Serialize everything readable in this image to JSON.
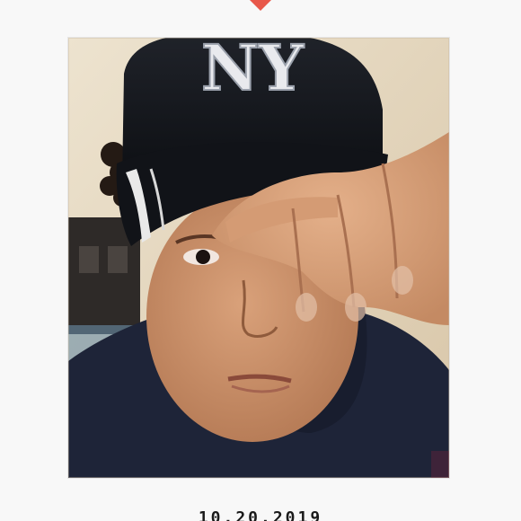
{
  "photo": {
    "cap_text": "NY",
    "date_caption": "10.20.2019"
  },
  "colors": {
    "background": "#f8f8f8",
    "heart": "#e8584a",
    "cap": "#15171c",
    "hoodie": "#1e2438",
    "skin": "#c98f6a",
    "wall": "#e7dcc6"
  },
  "icons": {
    "heart": "heart-icon"
  }
}
